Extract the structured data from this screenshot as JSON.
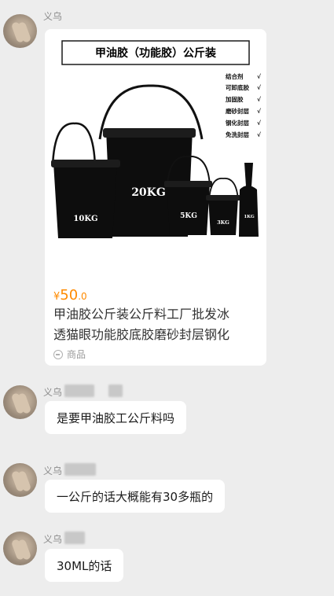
{
  "messages": [
    {
      "sender": "义乌",
      "type": "product_card",
      "card": {
        "banner": "甲油胶（功能胶）公斤装",
        "features": [
          "结合剂",
          "可卸底胶",
          "加固胶",
          "磨砂封层",
          "钢化封层",
          "免洗封层"
        ],
        "check": "√",
        "buckets": [
          "20KG",
          "10KG",
          "5KG",
          "3KG",
          "1KG"
        ],
        "price_symbol": "¥",
        "price_int": "50",
        "price_dec": ".0",
        "title_line1": "甲油胶公斤装公斤料工厂批发冰",
        "title_line2": "透猫眼功能胶底胶磨砂封层钢化",
        "footer_label": "商品"
      }
    },
    {
      "sender": "义乌",
      "type": "text",
      "text": "是要甲油胶工公斤料吗"
    },
    {
      "sender": "义乌",
      "type": "text",
      "text": "一公斤的话大概能有30多瓶的"
    },
    {
      "sender": "义乌",
      "type": "text",
      "text": "30ML的话"
    }
  ]
}
